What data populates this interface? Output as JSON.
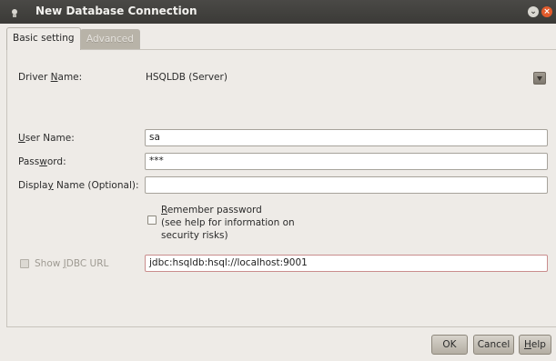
{
  "window": {
    "title": "New Database Connection",
    "minimize_glyph": "⌄",
    "close_glyph": "×"
  },
  "tabs": [
    {
      "label": "Basic setting",
      "active": true
    },
    {
      "label": "Advanced",
      "active": false
    }
  ],
  "form": {
    "driver_label_pre": "Driver ",
    "driver_label_u": "N",
    "driver_label_post": "ame:",
    "driver_value": "HSQLDB (Server)",
    "user_label_pre": "",
    "user_label_u": "U",
    "user_label_post": "ser Name:",
    "user_value": "sa",
    "password_label_pre": "Pass",
    "password_label_u": "w",
    "password_label_post": "ord:",
    "password_value": "***",
    "display_label_pre": "Displa",
    "display_label_u": "y",
    "display_label_post": " Name (Optional):",
    "display_value": "",
    "remember_line1_pre": "",
    "remember_line1_u": "R",
    "remember_line1_post": "emember password",
    "remember_line2": "(see help for information on",
    "remember_line3": "security risks)",
    "remember_checked": false,
    "jdbc_label_pre": "Show ",
    "jdbc_label_u": "J",
    "jdbc_label_post": "DBC URL",
    "jdbc_checked": true,
    "jdbc_value": "jdbc:hsqldb:hsql://localhost:9001"
  },
  "buttons": {
    "ok": "OK",
    "cancel": "Cancel",
    "help_u": "H",
    "help_post": "elp"
  },
  "icons": {
    "app": "database-app-icon",
    "dropdown": "chevron-down-icon"
  },
  "colors": {
    "titlebar": "#3b3a37",
    "close_button": "#e25b2c",
    "dialog_bg": "#eeebe7"
  }
}
